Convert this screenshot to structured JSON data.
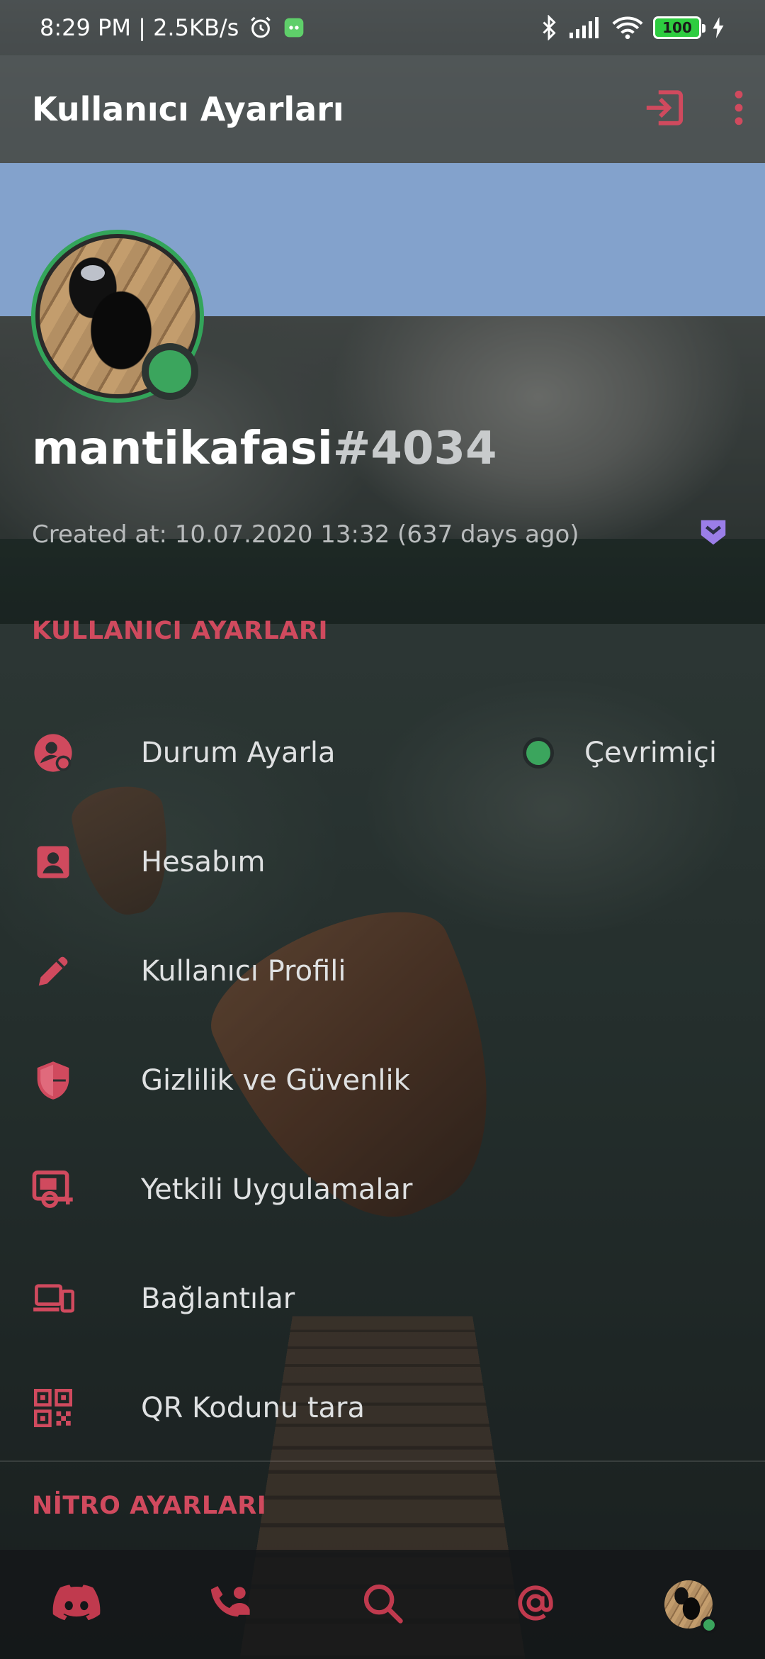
{
  "status_bar": {
    "time_speed": "8:29 PM | 2.5KB/s",
    "battery": "100"
  },
  "app_bar": {
    "title": "Kullanıcı Ayarları"
  },
  "profile": {
    "username": "mantikafasi",
    "discriminator": "#4034",
    "created_at": "Created at: 10.07.2020 13:32 (637 days ago)",
    "presence_color": "#3ba55d"
  },
  "sections": {
    "user_settings_header": "KULLANICI AYARLARI",
    "nitro_settings_header": "NİTRO AYARLARI"
  },
  "menu": {
    "items": [
      {
        "label": "Durum Ayarla",
        "value": "Çevrimiçi",
        "icon": "status-person-icon"
      },
      {
        "label": "Hesabım",
        "icon": "account-card-icon"
      },
      {
        "label": "Kullanıcı Profili",
        "icon": "pencil-icon"
      },
      {
        "label": "Gizlilik ve Güvenlik",
        "icon": "shield-icon"
      },
      {
        "label": "Yetkili Uygulamalar",
        "icon": "authorized-apps-icon"
      },
      {
        "label": "Bağlantılar",
        "icon": "devices-icon"
      },
      {
        "label": "QR Kodunu tara",
        "icon": "qr-code-icon"
      }
    ]
  },
  "bottom_nav": {
    "items": [
      "discord-home-icon",
      "friends-icon",
      "search-icon",
      "mentions-icon",
      "user-avatar"
    ]
  },
  "colors": {
    "accent": "#d04a5e",
    "banner": "#83a2cc",
    "online": "#3ba55d",
    "hypesquad": "#9b7ee8"
  }
}
